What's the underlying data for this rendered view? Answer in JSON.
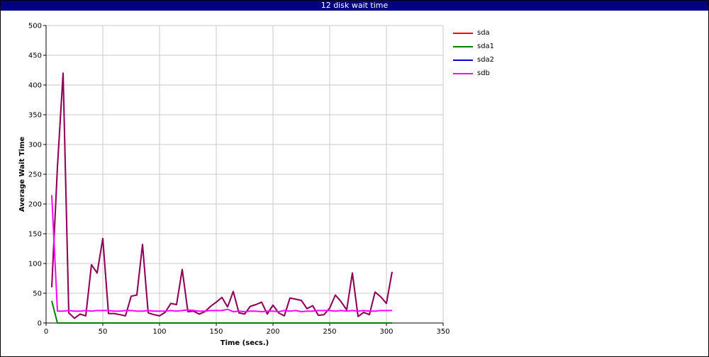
{
  "window": {
    "title": "12 disk wait time",
    "title_bg": "#000080"
  },
  "chart_data": {
    "type": "line",
    "xlabel": "Time (secs.)",
    "ylabel": "Average Wait Time",
    "xlim": [
      0,
      350
    ],
    "ylim": [
      0,
      500
    ],
    "xticks": [
      0,
      50,
      100,
      150,
      200,
      250,
      300,
      350
    ],
    "yticks": [
      0,
      50,
      100,
      150,
      200,
      250,
      300,
      350,
      400,
      450,
      500
    ],
    "grid": true,
    "legend_position": "right",
    "series": [
      {
        "name": "sda",
        "color": "#ff0000",
        "points": [
          [
            5,
            60
          ],
          [
            10,
            262
          ],
          [
            15,
            420
          ],
          [
            20,
            17
          ],
          [
            25,
            8
          ],
          [
            30,
            15
          ],
          [
            35,
            12
          ],
          [
            40,
            98
          ],
          [
            45,
            84
          ],
          [
            50,
            142
          ],
          [
            55,
            16
          ],
          [
            60,
            16
          ],
          [
            65,
            14
          ],
          [
            70,
            12
          ],
          [
            75,
            45
          ],
          [
            80,
            47
          ],
          [
            85,
            132
          ],
          [
            90,
            17
          ],
          [
            95,
            14
          ],
          [
            100,
            12
          ],
          [
            105,
            18
          ],
          [
            110,
            33
          ],
          [
            115,
            31
          ],
          [
            120,
            90
          ],
          [
            125,
            19
          ],
          [
            130,
            20
          ],
          [
            135,
            15
          ],
          [
            140,
            19
          ],
          [
            145,
            28
          ],
          [
            150,
            35
          ],
          [
            155,
            43
          ],
          [
            160,
            27
          ],
          [
            165,
            53
          ],
          [
            170,
            17
          ],
          [
            175,
            15
          ],
          [
            180,
            28
          ],
          [
            185,
            31
          ],
          [
            190,
            35
          ],
          [
            195,
            15
          ],
          [
            200,
            30
          ],
          [
            205,
            17
          ],
          [
            210,
            12
          ],
          [
            215,
            42
          ],
          [
            220,
            40
          ],
          [
            225,
            38
          ],
          [
            230,
            24
          ],
          [
            235,
            29
          ],
          [
            240,
            13
          ],
          [
            245,
            14
          ],
          [
            250,
            25
          ],
          [
            255,
            47
          ],
          [
            260,
            36
          ],
          [
            265,
            22
          ],
          [
            270,
            84
          ],
          [
            275,
            11
          ],
          [
            280,
            18
          ],
          [
            285,
            14
          ],
          [
            290,
            52
          ],
          [
            295,
            44
          ],
          [
            300,
            33
          ],
          [
            305,
            86
          ]
        ]
      },
      {
        "name": "sda1",
        "color": "#008000",
        "points": [
          [
            5,
            37
          ],
          [
            10,
            0
          ],
          [
            305,
            0
          ]
        ]
      },
      {
        "name": "sda2",
        "color": "#0000cc",
        "points": [
          [
            5,
            60
          ],
          [
            10,
            262
          ],
          [
            15,
            420
          ],
          [
            20,
            17
          ],
          [
            25,
            8
          ],
          [
            30,
            15
          ],
          [
            35,
            12
          ],
          [
            40,
            98
          ],
          [
            45,
            84
          ],
          [
            50,
            142
          ],
          [
            55,
            16
          ],
          [
            60,
            16
          ],
          [
            65,
            14
          ],
          [
            70,
            12
          ],
          [
            75,
            45
          ],
          [
            80,
            47
          ],
          [
            85,
            132
          ],
          [
            90,
            17
          ],
          [
            95,
            14
          ],
          [
            100,
            12
          ],
          [
            105,
            18
          ],
          [
            110,
            33
          ],
          [
            115,
            31
          ],
          [
            120,
            90
          ],
          [
            125,
            19
          ],
          [
            130,
            20
          ],
          [
            135,
            15
          ],
          [
            140,
            19
          ],
          [
            145,
            28
          ],
          [
            150,
            35
          ],
          [
            155,
            43
          ],
          [
            160,
            27
          ],
          [
            165,
            53
          ],
          [
            170,
            17
          ],
          [
            175,
            15
          ],
          [
            180,
            28
          ],
          [
            185,
            31
          ],
          [
            190,
            35
          ],
          [
            195,
            15
          ],
          [
            200,
            30
          ],
          [
            205,
            17
          ],
          [
            210,
            12
          ],
          [
            215,
            42
          ],
          [
            220,
            40
          ],
          [
            225,
            38
          ],
          [
            230,
            24
          ],
          [
            235,
            29
          ],
          [
            240,
            13
          ],
          [
            245,
            14
          ],
          [
            250,
            25
          ],
          [
            255,
            47
          ],
          [
            260,
            36
          ],
          [
            265,
            22
          ],
          [
            270,
            84
          ],
          [
            275,
            11
          ],
          [
            280,
            18
          ],
          [
            285,
            14
          ],
          [
            290,
            52
          ],
          [
            295,
            44
          ],
          [
            300,
            33
          ],
          [
            305,
            86
          ]
        ]
      },
      {
        "name": "sdb",
        "color": "#ff00ff",
        "points": [
          [
            5,
            215
          ],
          [
            10,
            20
          ],
          [
            15,
            20
          ],
          [
            20,
            21
          ],
          [
            25,
            20
          ],
          [
            30,
            20
          ],
          [
            35,
            21
          ],
          [
            40,
            20
          ],
          [
            45,
            21
          ],
          [
            50,
            21
          ],
          [
            55,
            21
          ],
          [
            60,
            20
          ],
          [
            65,
            20
          ],
          [
            70,
            21
          ],
          [
            75,
            21
          ],
          [
            80,
            20
          ],
          [
            85,
            20
          ],
          [
            90,
            21
          ],
          [
            95,
            20
          ],
          [
            100,
            20
          ],
          [
            105,
            20
          ],
          [
            110,
            21
          ],
          [
            115,
            20
          ],
          [
            120,
            21
          ],
          [
            125,
            22
          ],
          [
            130,
            21
          ],
          [
            135,
            20
          ],
          [
            140,
            20
          ],
          [
            145,
            21
          ],
          [
            150,
            21
          ],
          [
            155,
            21
          ],
          [
            160,
            23
          ],
          [
            165,
            19
          ],
          [
            170,
            20
          ],
          [
            175,
            19
          ],
          [
            180,
            20
          ],
          [
            185,
            20
          ],
          [
            190,
            19
          ],
          [
            195,
            20
          ],
          [
            200,
            20
          ],
          [
            205,
            19
          ],
          [
            210,
            21
          ],
          [
            215,
            20
          ],
          [
            220,
            21
          ],
          [
            225,
            19
          ],
          [
            230,
            20
          ],
          [
            235,
            20
          ],
          [
            240,
            21
          ],
          [
            245,
            21
          ],
          [
            250,
            21
          ],
          [
            255,
            20
          ],
          [
            260,
            21
          ],
          [
            265,
            20
          ],
          [
            270,
            21
          ],
          [
            275,
            20
          ],
          [
            280,
            21
          ],
          [
            285,
            20
          ],
          [
            290,
            20
          ],
          [
            295,
            21
          ],
          [
            300,
            21
          ],
          [
            305,
            21
          ]
        ]
      }
    ]
  }
}
